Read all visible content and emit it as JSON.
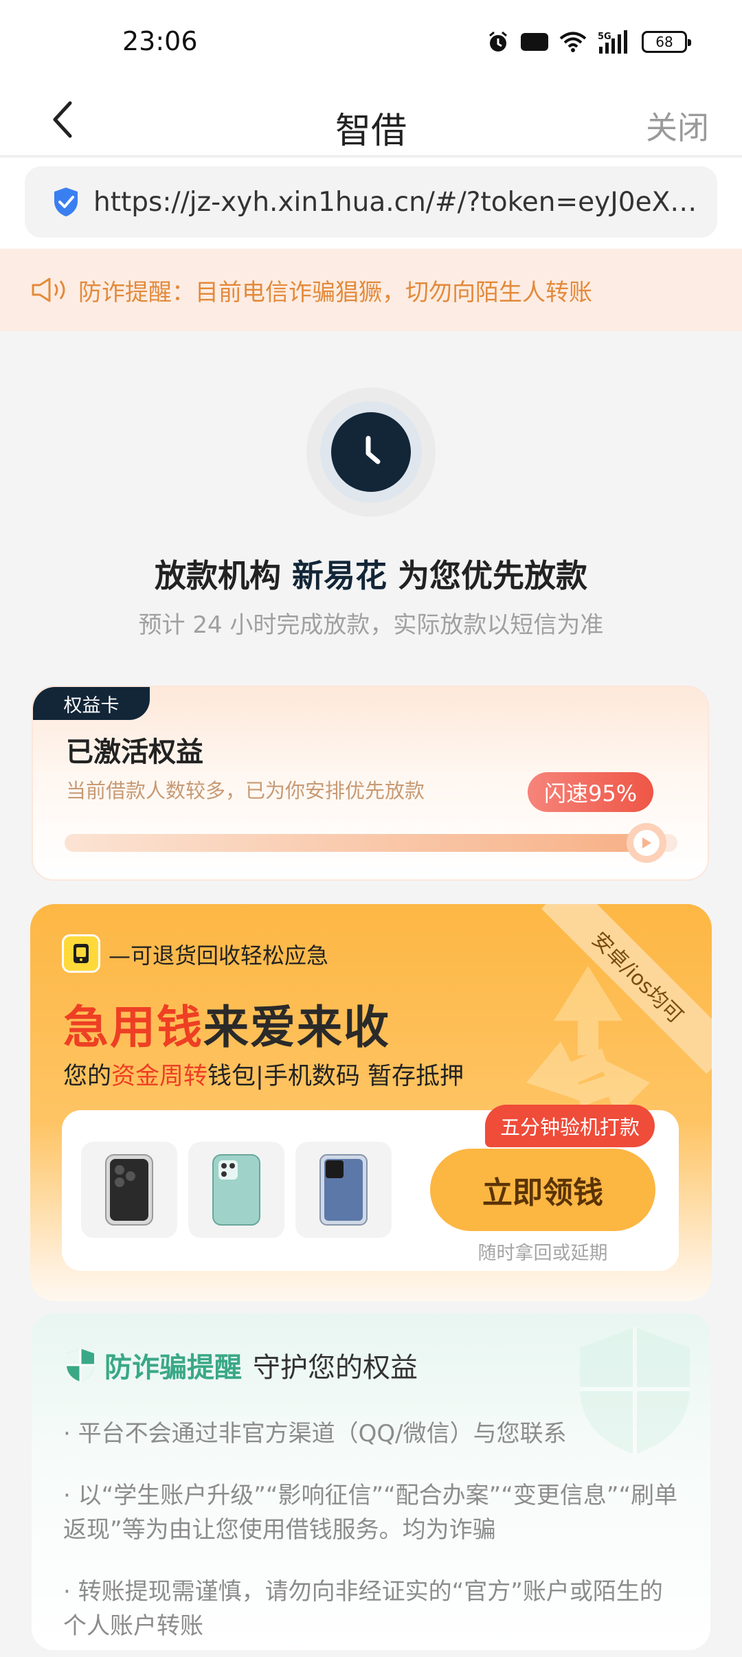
{
  "status_bar": {
    "time": "23:06",
    "icons": [
      "alarm-icon",
      "hd-icon",
      "wifi-icon",
      "5g-signal-icon",
      "battery-icon"
    ],
    "hd_label": "HD",
    "signal_label": "5G",
    "battery": "68"
  },
  "nav": {
    "title": "智借",
    "close_label": "关闭"
  },
  "url_bar": {
    "url": "https://jz-xyh.xin1hua.cn/#/?token=eyJ0eXAi..."
  },
  "notice": {
    "text": "防诈提醒：目前电信诈骗猖獗，切勿向陌生人转账"
  },
  "hero": {
    "headline_prefix": "放款机构",
    "headline_highlight": "新易花",
    "headline_suffix": "为您优先放款",
    "subline": "预计 24 小时完成放款，实际放款以短信为准"
  },
  "benefit_card": {
    "tag": "权益卡",
    "title": "已激活权益",
    "desc": "当前借款人数较多，已为你安排优先放款",
    "speed_label": "闪速95%",
    "progress": 0.95
  },
  "promo": {
    "tagline": "—可退货回收轻松应急",
    "title_red": "急用钱",
    "title_rest": "来爱来收",
    "sub_prefix": "您的",
    "sub_red": "资金周转",
    "sub_rest": "钱包|手机数码 暂存抵押",
    "ribbon": "安卓/ios均可",
    "claim_badge": "五分钟验机打款",
    "claim_button": "立即领钱",
    "claim_note": "随时拿回或延期",
    "colors": {
      "accent": "#fcb642",
      "red": "#ee3f24"
    }
  },
  "safety": {
    "title": "防诈骗提醒",
    "title2": "守护您的权益",
    "items": [
      "· 平台不会通过非官方渠道（QQ/微信）与您联系",
      "· 以“学生账户升级”“影响征信”“配合办案”“变更信息”“刷单返现”等为由让您使用借钱服务。均为诈骗",
      "· 转账提现需谨慎，请勿向非经证实的“官方”账户或陌生的个人账户转账"
    ]
  }
}
